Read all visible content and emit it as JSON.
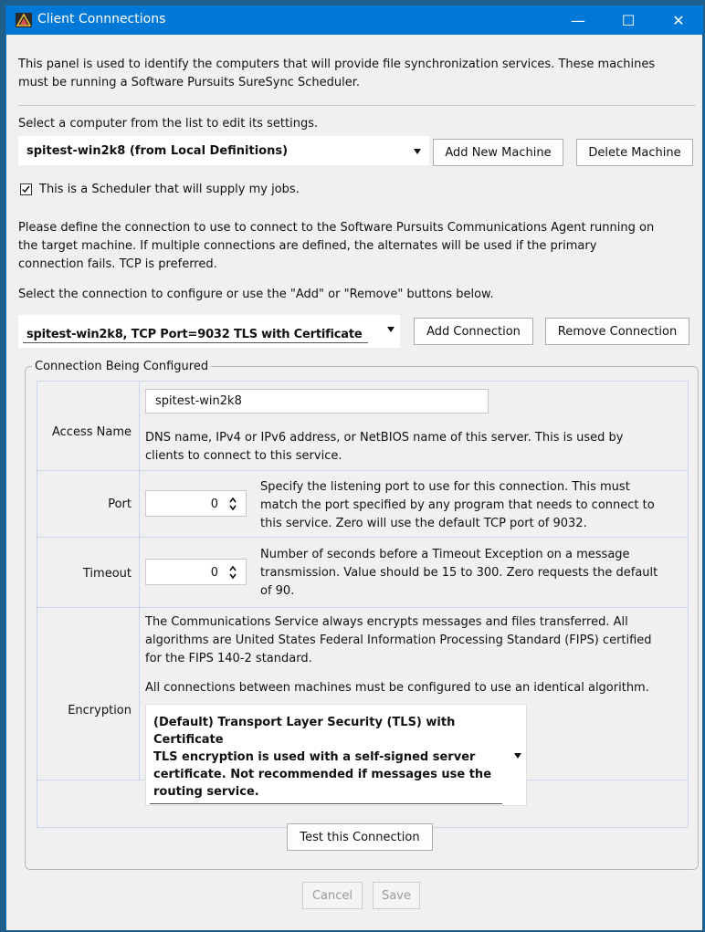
{
  "window": {
    "title": "Client Connnections",
    "controls": {
      "minimize": "—",
      "maximize": "☐",
      "close": "✕"
    }
  },
  "intro_text_1": "This panel is used to identify the computers that will provide file synchronization services. These machines",
  "intro_text_2": "must be running a Software Pursuits SureSync Scheduler.",
  "select_computer_label": "Select a computer from the list to edit its settings.",
  "computer_dropdown": {
    "value": "spitest-win2k8 (from Local Definitions)"
  },
  "add_machine_label": "Add New Machine",
  "delete_machine_label": "Delete Machine",
  "scheduler_checkbox": {
    "label": "This is a Scheduler that will supply my jobs.",
    "checked": true
  },
  "define_text_1": "Please define the connection to use to connect to the Software Pursuits Communications Agent running on",
  "define_text_2": "the target machine. If multiple connections are defined, the alternates will be used if the primary",
  "define_text_3": "connection fails. TCP is preferred.",
  "select_connection_label": "Select the connection to configure or use the \"Add\" or \"Remove\" buttons below.",
  "connection_dropdown": {
    "value": "spitest-win2k8, TCP Port=9032 TLS with Certificate"
  },
  "add_connection_label": "Add Connection",
  "remove_connection_label": "Remove Connection",
  "group_title": "Connection Being Configured",
  "access_name": {
    "label": "Access Name",
    "value": "spitest-win2k8",
    "desc_1": "DNS name, IPv4 or IPv6 address, or NetBIOS name of this server. This is used by",
    "desc_2": "clients to connect to this service."
  },
  "port": {
    "label": "Port",
    "value": "0",
    "desc_1": "Specify the listening port to use for this connection. This must",
    "desc_2": "match the port specified by any program that needs to connect to",
    "desc_3": "this service. Zero will use the default TCP port of 9032."
  },
  "timeout": {
    "label": "Timeout",
    "value": "0",
    "desc_1": "Number of seconds before a Timeout Exception on a message",
    "desc_2": "transmission. Value should be 15 to 300. Zero requests the default",
    "desc_3": "of 90."
  },
  "encryption": {
    "label": "Encryption",
    "desc_1": "The Communications Service always encrypts messages and files transferred. All",
    "desc_2": "algorithms are United States Federal Information Processing Standard (FIPS) certified",
    "desc_3": "for the FIPS 140-2 standard.",
    "desc_4": "All connections between machines must be configured to use an identical algorithm.",
    "selected_1": "(Default) Transport Layer Security (TLS) with",
    "selected_2": "Certificate",
    "selected_3": "TLS encryption is used with a self-signed server",
    "selected_4": "certificate. Not recommended if messages use the",
    "selected_5": "routing service."
  },
  "test_connection_label": "Test this Connection",
  "cancel_label": "Cancel",
  "save_label": "Save",
  "colors": {
    "titlebar": "#0078d7",
    "background": "#f0f0f0",
    "table_border": "#c8d6e8"
  }
}
